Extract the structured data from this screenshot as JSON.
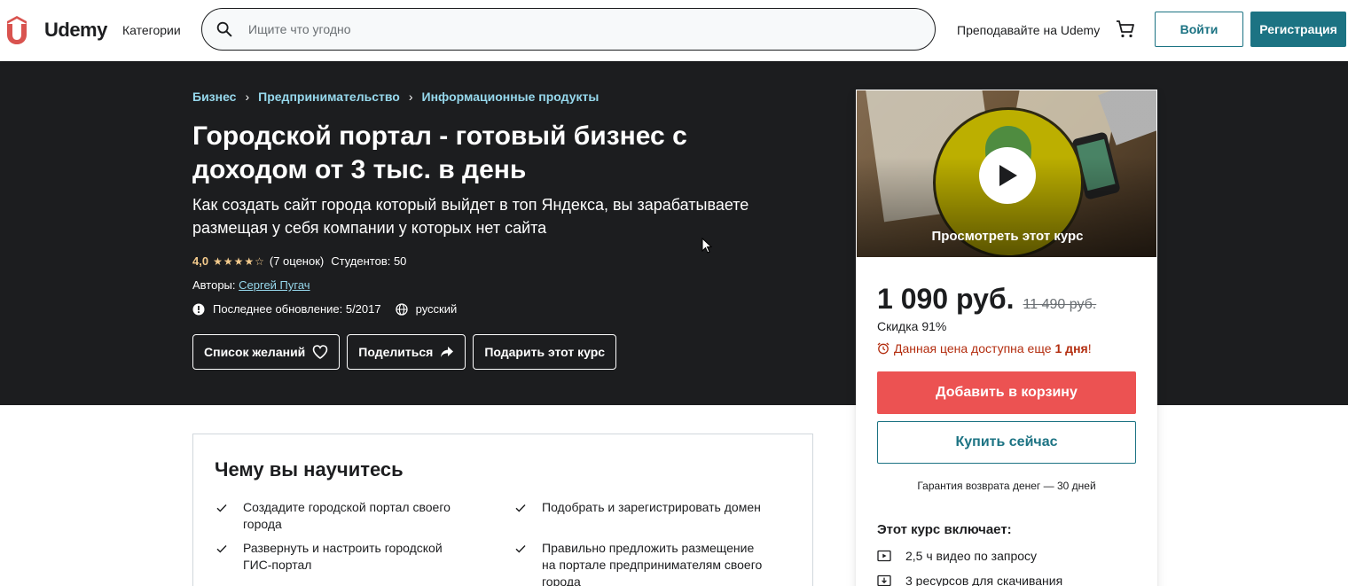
{
  "header": {
    "logo_text": "Udemy",
    "categories": "Категории",
    "search_placeholder": "Ищите что угодно",
    "teach": "Преподавайте на Udemy",
    "login": "Войти",
    "register": "Регистрация"
  },
  "breadcrumb": [
    "Бизнес",
    "Предпринимательство",
    "Информационные продукты"
  ],
  "course": {
    "title": "Городской портал - готовый бизнес с доходом от 3 тыс. в день",
    "subtitle": "Как создать сайт города который выйдет в топ Яндекса, вы зарабатываете размещая у себя компании у которых нет сайта",
    "rating": "4,0",
    "stars": "★★★★☆",
    "rating_count": "(7 оценок)",
    "students": "Студентов: 50",
    "authors_label": "Авторы:",
    "author": "Сергей Пугач",
    "last_update": "Последнее обновление: 5/2017",
    "language": "русский"
  },
  "actions": {
    "wishlist": "Список желаний",
    "share": "Поделиться",
    "gift": "Подарить этот курс"
  },
  "card": {
    "preview_label": "Просмотреть этот курс",
    "price": "1 090 руб.",
    "old_price": "11 490 руб.",
    "discount": "Скидка 91%",
    "timer_text": "Данная цена доступна еще",
    "timer_bold": "1 дня",
    "timer_end": "!",
    "add_to_cart": "Добавить в корзину",
    "buy_now": "Купить сейчас",
    "guarantee": "Гарантия возврата денег — 30 дней",
    "includes_title": "Этот курс включает:",
    "includes": [
      "2,5 ч видео по запросу",
      "3 ресурсов для скачивания"
    ]
  },
  "learn": {
    "title": "Чему вы научитесь",
    "items": [
      "Создадите городской портал своего города",
      "Подобрать и зарегистрировать домен",
      "Развернуть и настроить городской ГИС-портал",
      "Правильно предложить размещение на портале предпринимателям своего города"
    ]
  },
  "colors": {
    "brand": "#1c7383",
    "cart_button": "#ec5252",
    "hero_bg": "#1c1d1f",
    "star": "#f3ca8c",
    "timer": "#b32d0f",
    "link": "#96d8ec"
  }
}
